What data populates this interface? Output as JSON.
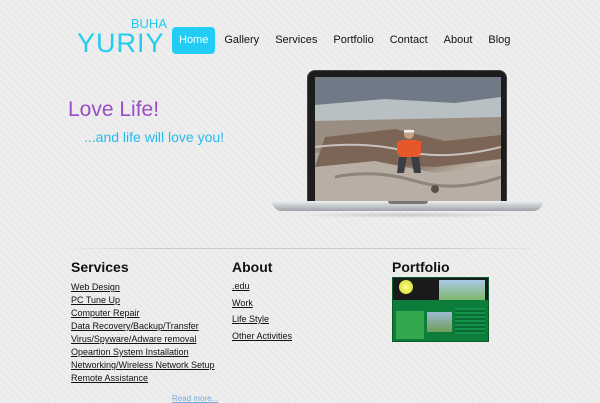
{
  "logo": {
    "top": "BUHA",
    "main": "YURIY"
  },
  "nav": {
    "items": [
      {
        "label": "Home"
      },
      {
        "label": "Gallery"
      },
      {
        "label": "Services"
      },
      {
        "label": "Portfolio"
      },
      {
        "label": "Contact"
      },
      {
        "label": "About"
      },
      {
        "label": "Blog"
      }
    ],
    "active": "Home"
  },
  "hero": {
    "tagline": "Love Life!",
    "subtagline": "...and life will love you!"
  },
  "services": {
    "heading": "Services",
    "items": [
      "Web Design",
      "PC Tune Up",
      "Computer Repair",
      "Data Recovery/Backup/Transfer",
      "Virus/Spyware/Adware removal",
      "Opeartion System Installation",
      "Networking/Wireless Network Setup",
      "Remote Assistance"
    ],
    "more": "Read more..."
  },
  "about": {
    "heading": "About",
    "items": [
      ".edu",
      "Work",
      "Life Style",
      "Other Activities"
    ]
  },
  "portfolio": {
    "heading": "Portfolio"
  },
  "colors": {
    "accent": "#22ccf5",
    "logo": "#22ccee",
    "tagline": "#9a4dc6",
    "subtagline": "#22bbee"
  }
}
